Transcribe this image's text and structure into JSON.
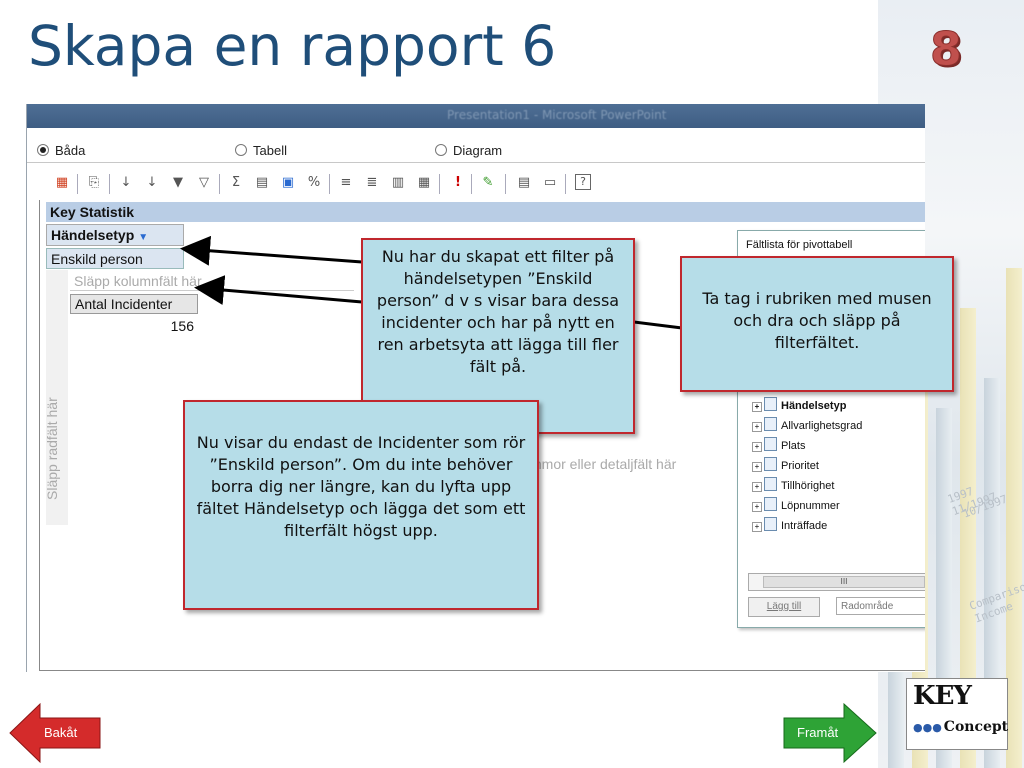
{
  "slide": {
    "title": "Skapa en rapport 6",
    "number": "8"
  },
  "window": {
    "title": "Presentation1 - Microsoft PowerPoint"
  },
  "view_options": [
    {
      "label": "Båda",
      "selected": true
    },
    {
      "label": "Tabell",
      "selected": false
    },
    {
      "label": "Diagram",
      "selected": false
    }
  ],
  "pivot": {
    "report_title": "Key Statistik",
    "filter_field": "Händelsetyp",
    "filter_value": "Enskild person",
    "drop_columns": "Släpp kolumnfält här",
    "drop_rows": "Släpp radfält här",
    "data_header": "Antal Incidenter",
    "data_value": "156",
    "drop_data": "mmor eller detaljfält här"
  },
  "field_list": {
    "title": "Fältlista för pivottabell",
    "items": [
      "Händelsetyp",
      "Allvarlighetsgrad",
      "Plats",
      "Prioritet",
      "Tillhörighet",
      "Löpnummer",
      "Inträffade"
    ],
    "add_label": "Lägg till",
    "area_value": "Radområde"
  },
  "callouts": {
    "filter": "Nu har du skapat ett filter på händelsetypen ”Enskild person” d v s visar bara dessa incidenter och har på nytt en ren arbetsyta att lägga till fler fält på.",
    "drag": "Ta tag i rubriken med musen och dra och släpp på filterfältet.",
    "incidents": "Nu visar du endast de Incidenter som rör ”Enskild person”. Om du inte behöver borra dig ner längre, kan du lyfta upp fältet Händelsetyp och lägga det som ett filterfält högst upp."
  },
  "nav": {
    "back": "Bakåt",
    "forward": "Framåt"
  },
  "logo": {
    "top": "KEY",
    "bottom": "Concept"
  },
  "colors": {
    "title": "#1f4e79",
    "callout_bg": "#b6dde8",
    "callout_border": "#c0272d",
    "back_button": "#d42b2b",
    "forward_button": "#2ea336"
  }
}
